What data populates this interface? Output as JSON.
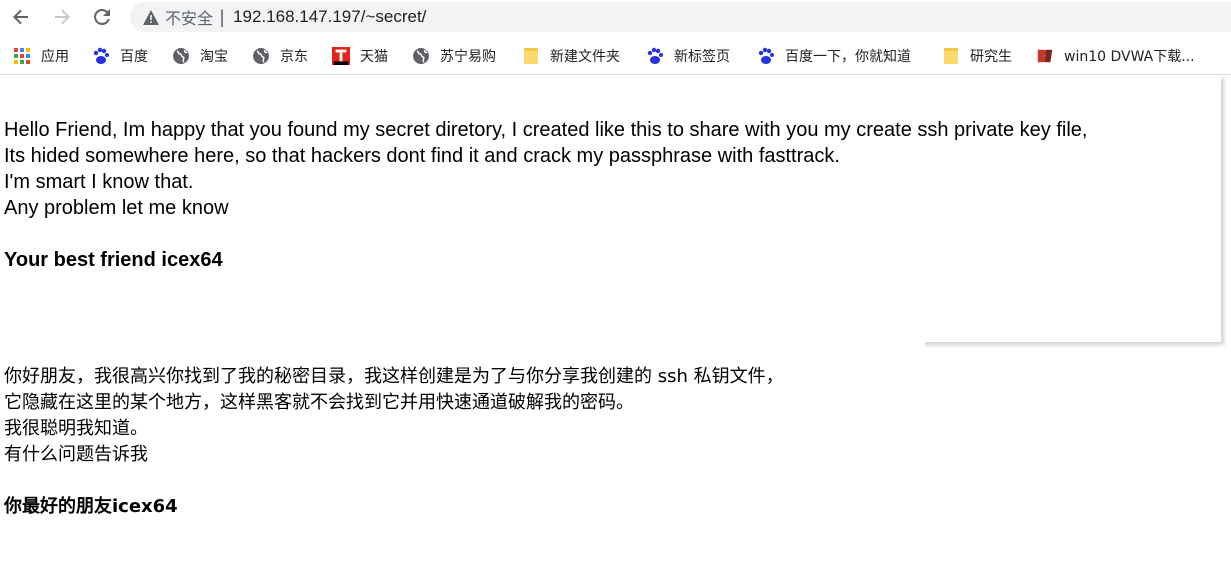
{
  "browser": {
    "security_label": "不安全",
    "separator": "|",
    "url": "192.168.147.197/~secret/"
  },
  "bookmarks": [
    {
      "label": "应用",
      "icon": "apps-grid-icon"
    },
    {
      "label": "百度",
      "icon": "baidu-paw-icon"
    },
    {
      "label": "淘宝",
      "icon": "globe-icon"
    },
    {
      "label": "京东",
      "icon": "globe-icon"
    },
    {
      "label": "天猫",
      "icon": "tmall-icon"
    },
    {
      "label": "苏宁易购",
      "icon": "globe-icon"
    },
    {
      "label": "新建文件夹",
      "icon": "folder-icon"
    },
    {
      "label": "新标签页",
      "icon": "baidu-paw-icon"
    },
    {
      "label": "百度一下，你就知道",
      "icon": "baidu-paw-icon"
    },
    {
      "label": "研究生",
      "icon": "folder-icon"
    },
    {
      "label": "win10 DVWA下载...",
      "icon": "dvwa-icon"
    }
  ],
  "message_en": {
    "line1": "Hello Friend, Im happy that you found my secret diretory, I created like this to share with you my create ssh private key file,",
    "line2": "Its hided somewhere here, so that hackers dont find it and crack my passphrase with fasttrack.",
    "line3": "I'm smart I know that.",
    "line4": "Any problem let me know",
    "signature": "Your best friend icex64"
  },
  "message_zh": {
    "line1": "你好朋友，我很高兴你找到了我的秘密目录，我这样创建是为了与你分享我创建的 ssh 私钥文件，",
    "line2": "它隐藏在这里的某个地方，这样黑客就不会找到它并用快速通道破解我的密码。",
    "line3": "我很聪明我知道。",
    "line4": "有什么问题告诉我",
    "signature": "你最好的朋友icex64"
  },
  "colors": {
    "toolbar_icon": "#5f6368",
    "omnibox_bg": "#f1f3f4",
    "baidu_blue": "#2932e1",
    "tmall_red": "#e1251b",
    "folder_yellow": "#f9d86e"
  }
}
